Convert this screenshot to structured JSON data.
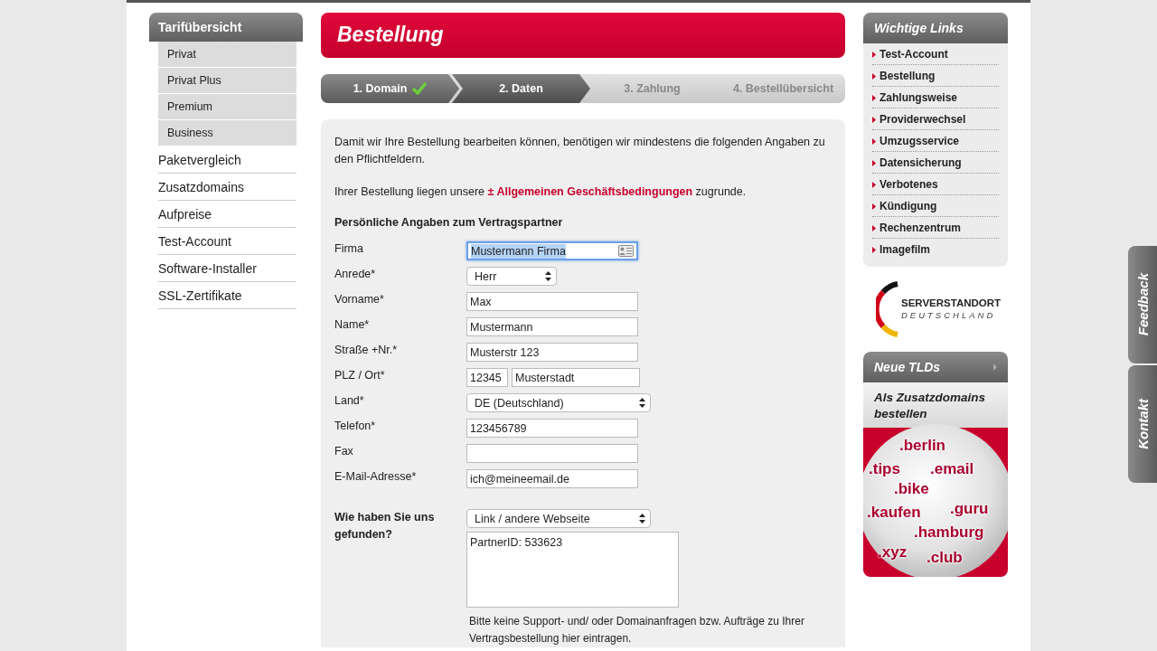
{
  "sidebar": {
    "heading": "Tarifübersicht",
    "subitems": [
      "Privat",
      "Privat Plus",
      "Premium",
      "Business"
    ],
    "items": [
      "Paketvergleich",
      "Zusatzdomains",
      "Aufpreise",
      "Test-Account",
      "Software-Installer",
      "SSL-Zertifikate"
    ]
  },
  "main": {
    "title": "Bestellung",
    "steps": [
      {
        "label": "1. Domain",
        "completed": true,
        "selected": false
      },
      {
        "label": "2. Daten",
        "completed": false,
        "selected": true
      },
      {
        "label": "3. Zahlung",
        "completed": false,
        "selected": false
      },
      {
        "label": "4. Bestellübersicht",
        "completed": false,
        "selected": false
      }
    ],
    "intro": "Damit wir Ihre Bestellung bearbeiten können, benötigen wir mindestens die folgenden Angaben zu den Pflichtfeldern.",
    "terms": {
      "before": "Ihrer Bestellung liegen unsere",
      "link": "± Allgemeinen Geschäftsbedingungen",
      "after": "zugrunde."
    },
    "section_title": "Persönliche Angaben zum Vertragspartner",
    "fields": [
      {
        "kind": "text",
        "label": "Firma",
        "value": "Mustermann Firma",
        "focused": true
      },
      {
        "kind": "select",
        "label": "Anrede*",
        "value": "Herr"
      },
      {
        "kind": "text",
        "label": "Vorname*",
        "value": "Max",
        "focused": false
      },
      {
        "kind": "text",
        "label": "Name*",
        "value": "Mustermann",
        "focused": false
      },
      {
        "kind": "text",
        "label": "Straße +Nr.*",
        "value": "Musterstr 123",
        "focused": false
      },
      {
        "kind": "pair",
        "label": "PLZ / Ort*",
        "value": "12345",
        "value2": "Musterstadt"
      },
      {
        "kind": "wideselect",
        "label": "Land*",
        "value": "DE (Deutschland)"
      },
      {
        "kind": "text",
        "label": "Telefon*",
        "value": "123456789",
        "focused": false
      },
      {
        "kind": "text",
        "label": "Fax",
        "focused": false
      },
      {
        "kind": "text",
        "label": "E-Mail-Adresse*",
        "value": "ich@meineemail.de",
        "focused": false
      }
    ],
    "found": {
      "label": "Wie haben Sie uns gefunden?",
      "select": "Link / andere Webseite",
      "textarea": "PartnerID: 533623",
      "note": "Bitte keine Support- und/ oder Domainanfragen bzw. Aufträge zu Ihrer Vertragsbestellung hier eintragen."
    }
  },
  "links": {
    "title": "Wichtige Links",
    "items": [
      "Test-Account",
      "Bestellung",
      "Zahlungsweise",
      "Providerwechsel",
      "Umzugsservice",
      "Datensicherung",
      "Verbotenes",
      "Kündigung",
      "Rechenzentrum",
      "Imagefilm"
    ]
  },
  "badge": {
    "line1": "SERVERSTANDORT",
    "line2": "DEUTSCHLAND"
  },
  "tlds": {
    "title": "Neue TLDs",
    "subtitle": "Als Zusatzdomains bestellen",
    "words": [
      ".berlin",
      ".tips",
      ".email",
      ".bike",
      ".guru",
      ".kaufen",
      ".hamburg",
      ".xyz",
      ".club"
    ]
  },
  "side_tabs": [
    "Feedback",
    "Kontakt"
  ]
}
